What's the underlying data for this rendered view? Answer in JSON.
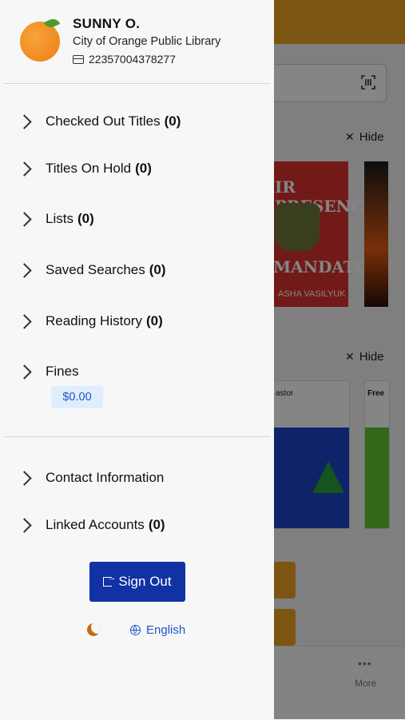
{
  "profile": {
    "name": "SUNNY O.",
    "library": "City of Orange Public Library",
    "card_number": "22357004378277"
  },
  "menu": {
    "checked_out": {
      "label": "Checked Out Titles",
      "count": "(0)"
    },
    "on_hold": {
      "label": "Titles On Hold",
      "count": "(0)"
    },
    "lists": {
      "label": "Lists",
      "count": "(0)"
    },
    "saved_searches": {
      "label": "Saved Searches",
      "count": "(0)"
    },
    "reading_history": {
      "label": "Reading History",
      "count": "(0)"
    },
    "fines": {
      "label": "Fines",
      "amount": "$0.00"
    },
    "contact": {
      "label": "Contact Information"
    },
    "linked": {
      "label": "Linked Accounts",
      "count": "(0)"
    }
  },
  "actions": {
    "sign_out": "Sign Out",
    "language": "English"
  },
  "background": {
    "hide_label": "Hide",
    "more_label": "More",
    "book1_title_top": "IR PRESENCE",
    "book1_title_bottom": "MANDATORY",
    "book1_author": "ASHA VASILYUK",
    "book3_title": "astor",
    "book4_title": "Free"
  },
  "colors": {
    "accent_orange": "#f0a325",
    "sign_out_blue": "#1131a5",
    "link_blue": "#1e57c5",
    "badge_bg": "#dfeefc"
  }
}
